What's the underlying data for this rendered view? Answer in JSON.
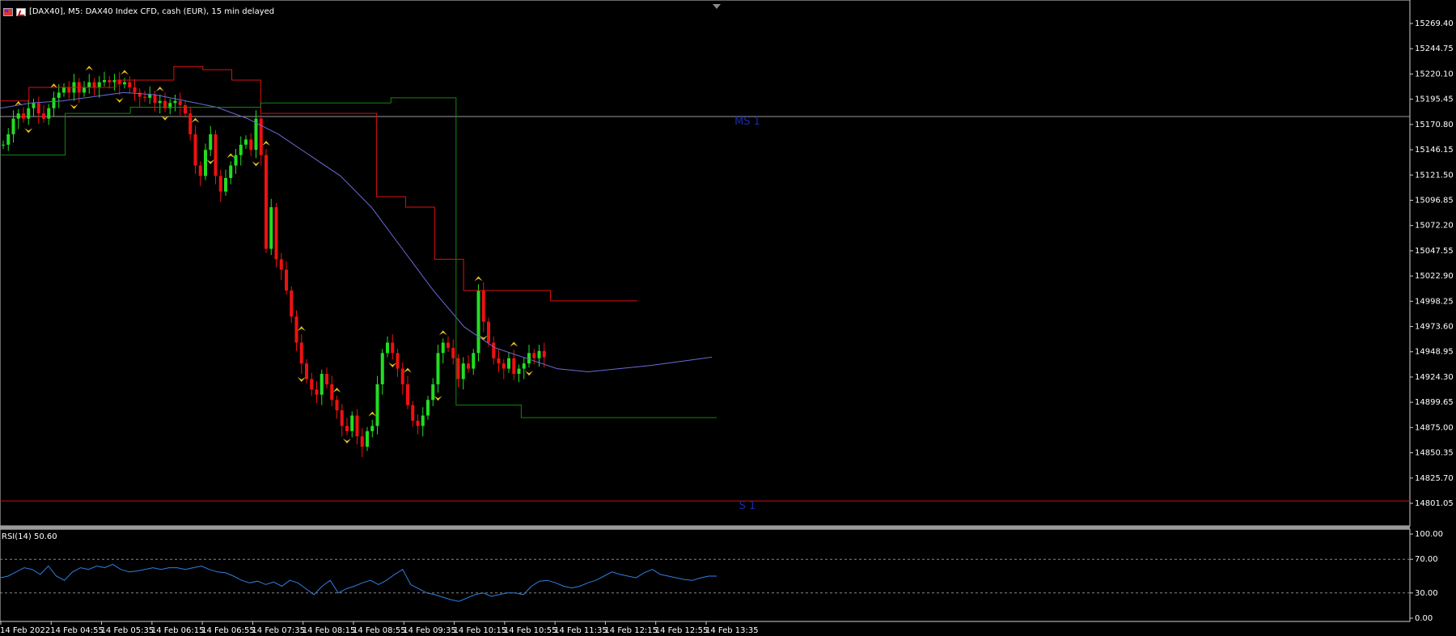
{
  "window": {
    "title": "[DAX40], M5:  DAX40 Index CFD, cash (EUR), 15 min delayed"
  },
  "colors": {
    "background": "#000000",
    "bull_candle": "#22dd22",
    "bear_candle": "#ee1111",
    "ma_line": "#6b6bd6",
    "upper_stop": "#dd1111",
    "lower_stop": "#118811",
    "fractal": "#e8c020",
    "rsi_line": "#2f7fe0",
    "level_ms1": "#9a9a9a",
    "level_s1": "#cc1111",
    "level_text": "#1a2aa8",
    "axis_text": "#ffffff"
  },
  "chart_data": [
    {
      "type": "candlestick",
      "symbol": "DAX40",
      "timeframe": "M5",
      "price_axis_labels": [
        "15269.40",
        "15244.75",
        "15220.10",
        "15195.45",
        "15170.80",
        "15146.15",
        "15121.50",
        "15096.85",
        "15072.20",
        "15047.55",
        "15022.90",
        "14998.25",
        "14973.60",
        "14948.95",
        "14924.30",
        "14899.65",
        "14875.00",
        "14850.35",
        "14825.70",
        "14801.05"
      ],
      "ylim": [
        14784,
        15285
      ],
      "time_axis_labels": [
        "14 Feb 2022",
        "14 Feb 04:55",
        "14 Feb 05:35",
        "14 Feb 06:15",
        "14 Feb 06:55",
        "14 Feb 07:35",
        "14 Feb 08:15",
        "14 Feb 08:55",
        "14 Feb 09:35",
        "14 Feb 10:15",
        "14 Feb 10:55",
        "14 Feb 11:35",
        "14 Feb 12:15",
        "14 Feb 12:55",
        "14 Feb 13:35"
      ],
      "levels": [
        {
          "label": "MS 1",
          "price": 15177
        },
        {
          "label": "S 1",
          "price": 14808
        }
      ],
      "close_path": [
        15150,
        15160,
        15175,
        15180,
        15175,
        15185,
        15190,
        15180,
        15175,
        15185,
        15195,
        15200,
        15205,
        15200,
        15210,
        15200,
        15205,
        15210,
        15205,
        15210,
        15212,
        15210,
        15212,
        15208,
        15210,
        15205,
        15200,
        15196,
        15195,
        15198,
        15190,
        15192,
        15185,
        15190,
        15192,
        15188,
        15180,
        15160,
        15130,
        15120,
        15145,
        15160,
        15120,
        15105,
        15118,
        15130,
        15140,
        15150,
        15155,
        15145,
        15175,
        15140,
        15050,
        15090,
        15040,
        15030,
        15010,
        14985,
        14960,
        14940,
        14925,
        14915,
        14910,
        14930,
        14920,
        14905,
        14895,
        14880,
        14875,
        14890,
        14870,
        14860,
        14875,
        14880,
        14920,
        14950,
        14960,
        14950,
        14935,
        14920,
        14900,
        14885,
        14880,
        14890,
        14905,
        14920,
        14950,
        14960,
        14955,
        14945,
        14925,
        14940,
        14935,
        14950,
        15010,
        14980,
        14960,
        14945,
        14940,
        14935,
        14945,
        14930,
        14935,
        14940,
        14950,
        14945,
        14952,
        14946
      ],
      "ma_path": [
        15185,
        15190,
        15192,
        15196,
        15200,
        15198,
        15192,
        15186,
        15175,
        15160,
        15140,
        15120,
        15090,
        15050,
        15010,
        14975,
        14955,
        14945,
        14935,
        14932,
        14935,
        14938,
        14942,
        14946
      ],
      "upper_stop_path": [
        15192,
        15205,
        15205,
        15205,
        15212,
        15212,
        15225,
        15222,
        15212,
        15180,
        15180,
        15180,
        15180,
        15100,
        15090,
        15040,
        15010,
        15010,
        15010,
        15000,
        15000,
        15000
      ],
      "lower_stop_path": [
        15140,
        15180,
        15186,
        15186,
        15190,
        15190,
        15195,
        14900,
        14888,
        14888,
        14888
      ]
    },
    {
      "type": "line",
      "indicator": "RSI(14)",
      "label": "RSI(14) 50.60",
      "current_value": 50.6,
      "axis_labels": [
        "100.00",
        "70.00",
        "30.00",
        "0.00"
      ],
      "ylim": [
        0,
        100
      ],
      "levels": [
        70,
        30
      ],
      "values": [
        48,
        50,
        55,
        60,
        58,
        52,
        62,
        50,
        45,
        55,
        60,
        58,
        62,
        60,
        64,
        58,
        55,
        56,
        58,
        60,
        58,
        60,
        60,
        58,
        60,
        62,
        58,
        55,
        54,
        50,
        45,
        42,
        44,
        40,
        43,
        38,
        45,
        42,
        35,
        28,
        38,
        45,
        30,
        35,
        38,
        42,
        45,
        40,
        45,
        52,
        58,
        40,
        35,
        30,
        28,
        25,
        22,
        20,
        24,
        28,
        30,
        26,
        28,
        30,
        30,
        28,
        38,
        44,
        45,
        42,
        38,
        36,
        38,
        42,
        45,
        50,
        55,
        52,
        50,
        48,
        54,
        58,
        52,
        50,
        48,
        46,
        45,
        48,
        50,
        50
      ]
    }
  ]
}
